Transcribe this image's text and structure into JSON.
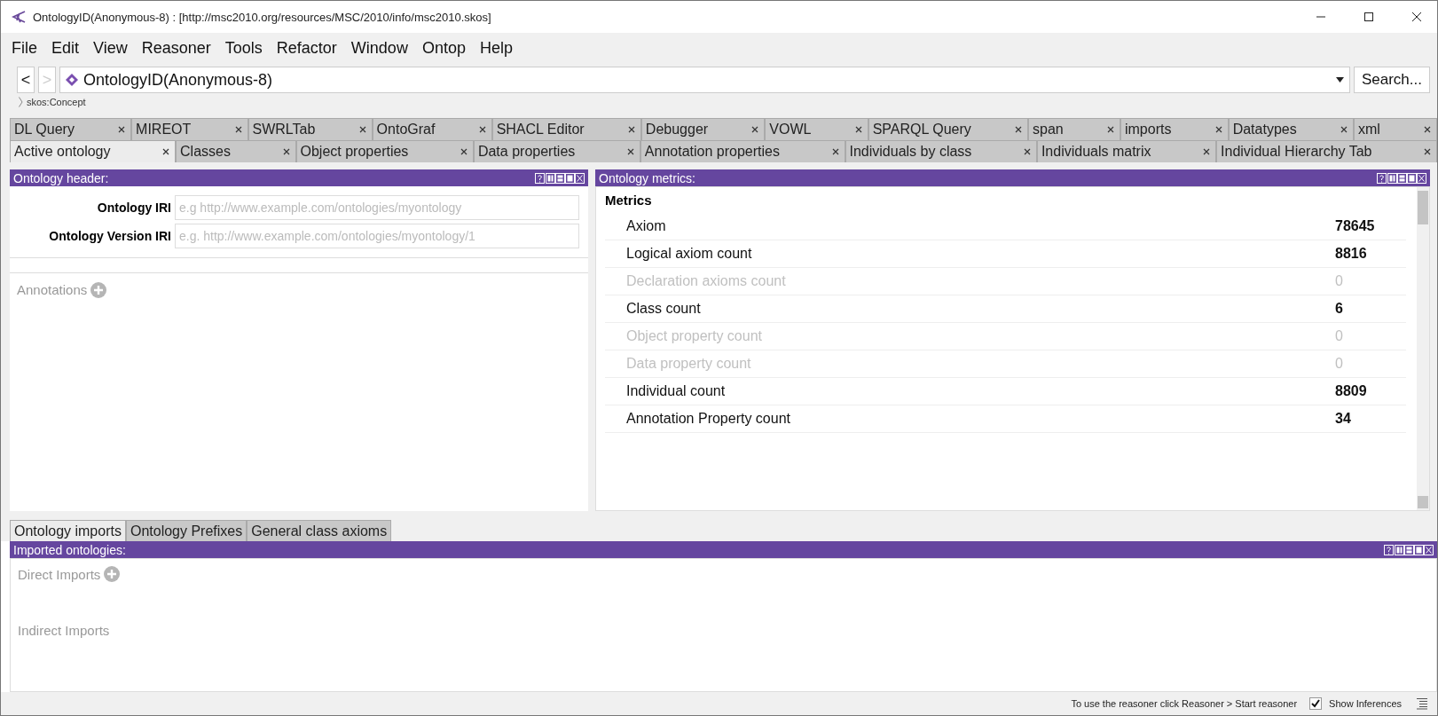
{
  "window": {
    "title": "OntologyID(Anonymous-8) : [http://msc2010.org/resources/MSC/2010/info/msc2010.skos]"
  },
  "menu": [
    "File",
    "Edit",
    "View",
    "Reasoner",
    "Tools",
    "Refactor",
    "Window",
    "Ontop",
    "Help"
  ],
  "nav": {
    "back": {
      "label": "<",
      "disabled": false
    },
    "forward": {
      "label": ">",
      "disabled": true
    },
    "entity": "OntologyID(Anonymous-8)",
    "search_button": "Search...",
    "breadcrumb": "skos:Concept"
  },
  "tab_rows": [
    [
      {
        "label": "DL Query",
        "selected": false
      },
      {
        "label": "MIREOT",
        "selected": false
      },
      {
        "label": "SWRLTab",
        "selected": false
      },
      {
        "label": "OntoGraf",
        "selected": false
      },
      {
        "label": "SHACL Editor",
        "selected": false
      },
      {
        "label": "Debugger",
        "selected": false
      },
      {
        "label": "VOWL",
        "selected": false
      },
      {
        "label": "SPARQL Query",
        "selected": false
      },
      {
        "label": "span",
        "selected": false
      },
      {
        "label": "imports",
        "selected": false
      },
      {
        "label": "Datatypes",
        "selected": false
      },
      {
        "label": "xml",
        "selected": false
      }
    ],
    [
      {
        "label": "Active ontology",
        "selected": true
      },
      {
        "label": "Classes",
        "selected": false
      },
      {
        "label": "Object properties",
        "selected": false
      },
      {
        "label": "Data properties",
        "selected": false
      },
      {
        "label": "Annotation properties",
        "selected": false
      },
      {
        "label": "Individuals by class",
        "selected": false
      },
      {
        "label": "Individuals matrix",
        "selected": false
      },
      {
        "label": "Individual Hierarchy Tab",
        "selected": false
      }
    ]
  ],
  "ontology_header": {
    "title": "Ontology header:",
    "fields": [
      {
        "label": "Ontology IRI",
        "placeholder": "e.g http://www.example.com/ontologies/myontology"
      },
      {
        "label": "Ontology Version IRI",
        "placeholder": "e.g. http://www.example.com/ontologies/myontology/1"
      }
    ],
    "annotations_label": "Annotations"
  },
  "ontology_metrics": {
    "title": "Ontology metrics:",
    "heading": "Metrics",
    "rows": [
      {
        "name": "Axiom",
        "value": "78645",
        "disabled": false
      },
      {
        "name": "Logical axiom count",
        "value": "8816",
        "disabled": false
      },
      {
        "name": "Declaration axioms count",
        "value": "0",
        "disabled": true
      },
      {
        "name": "Class count",
        "value": "6",
        "disabled": false
      },
      {
        "name": "Object property count",
        "value": "0",
        "disabled": true
      },
      {
        "name": "Data property count",
        "value": "0",
        "disabled": true
      },
      {
        "name": "Individual count",
        "value": "8809",
        "disabled": false
      },
      {
        "name": "Annotation Property count",
        "value": "34",
        "disabled": false
      }
    ]
  },
  "bottom_tabs": [
    {
      "label": "Ontology imports",
      "selected": true
    },
    {
      "label": "Ontology Prefixes",
      "selected": false
    },
    {
      "label": "General class axioms",
      "selected": false
    }
  ],
  "imported_ontologies": {
    "title": "Imported ontologies:",
    "direct_label": "Direct Imports",
    "indirect_label": "Indirect Imports"
  },
  "status_bar": {
    "message": "To use the reasoner click Reasoner > Start reasoner",
    "show_inferences": {
      "label": "Show Inferences",
      "checked": true
    }
  }
}
